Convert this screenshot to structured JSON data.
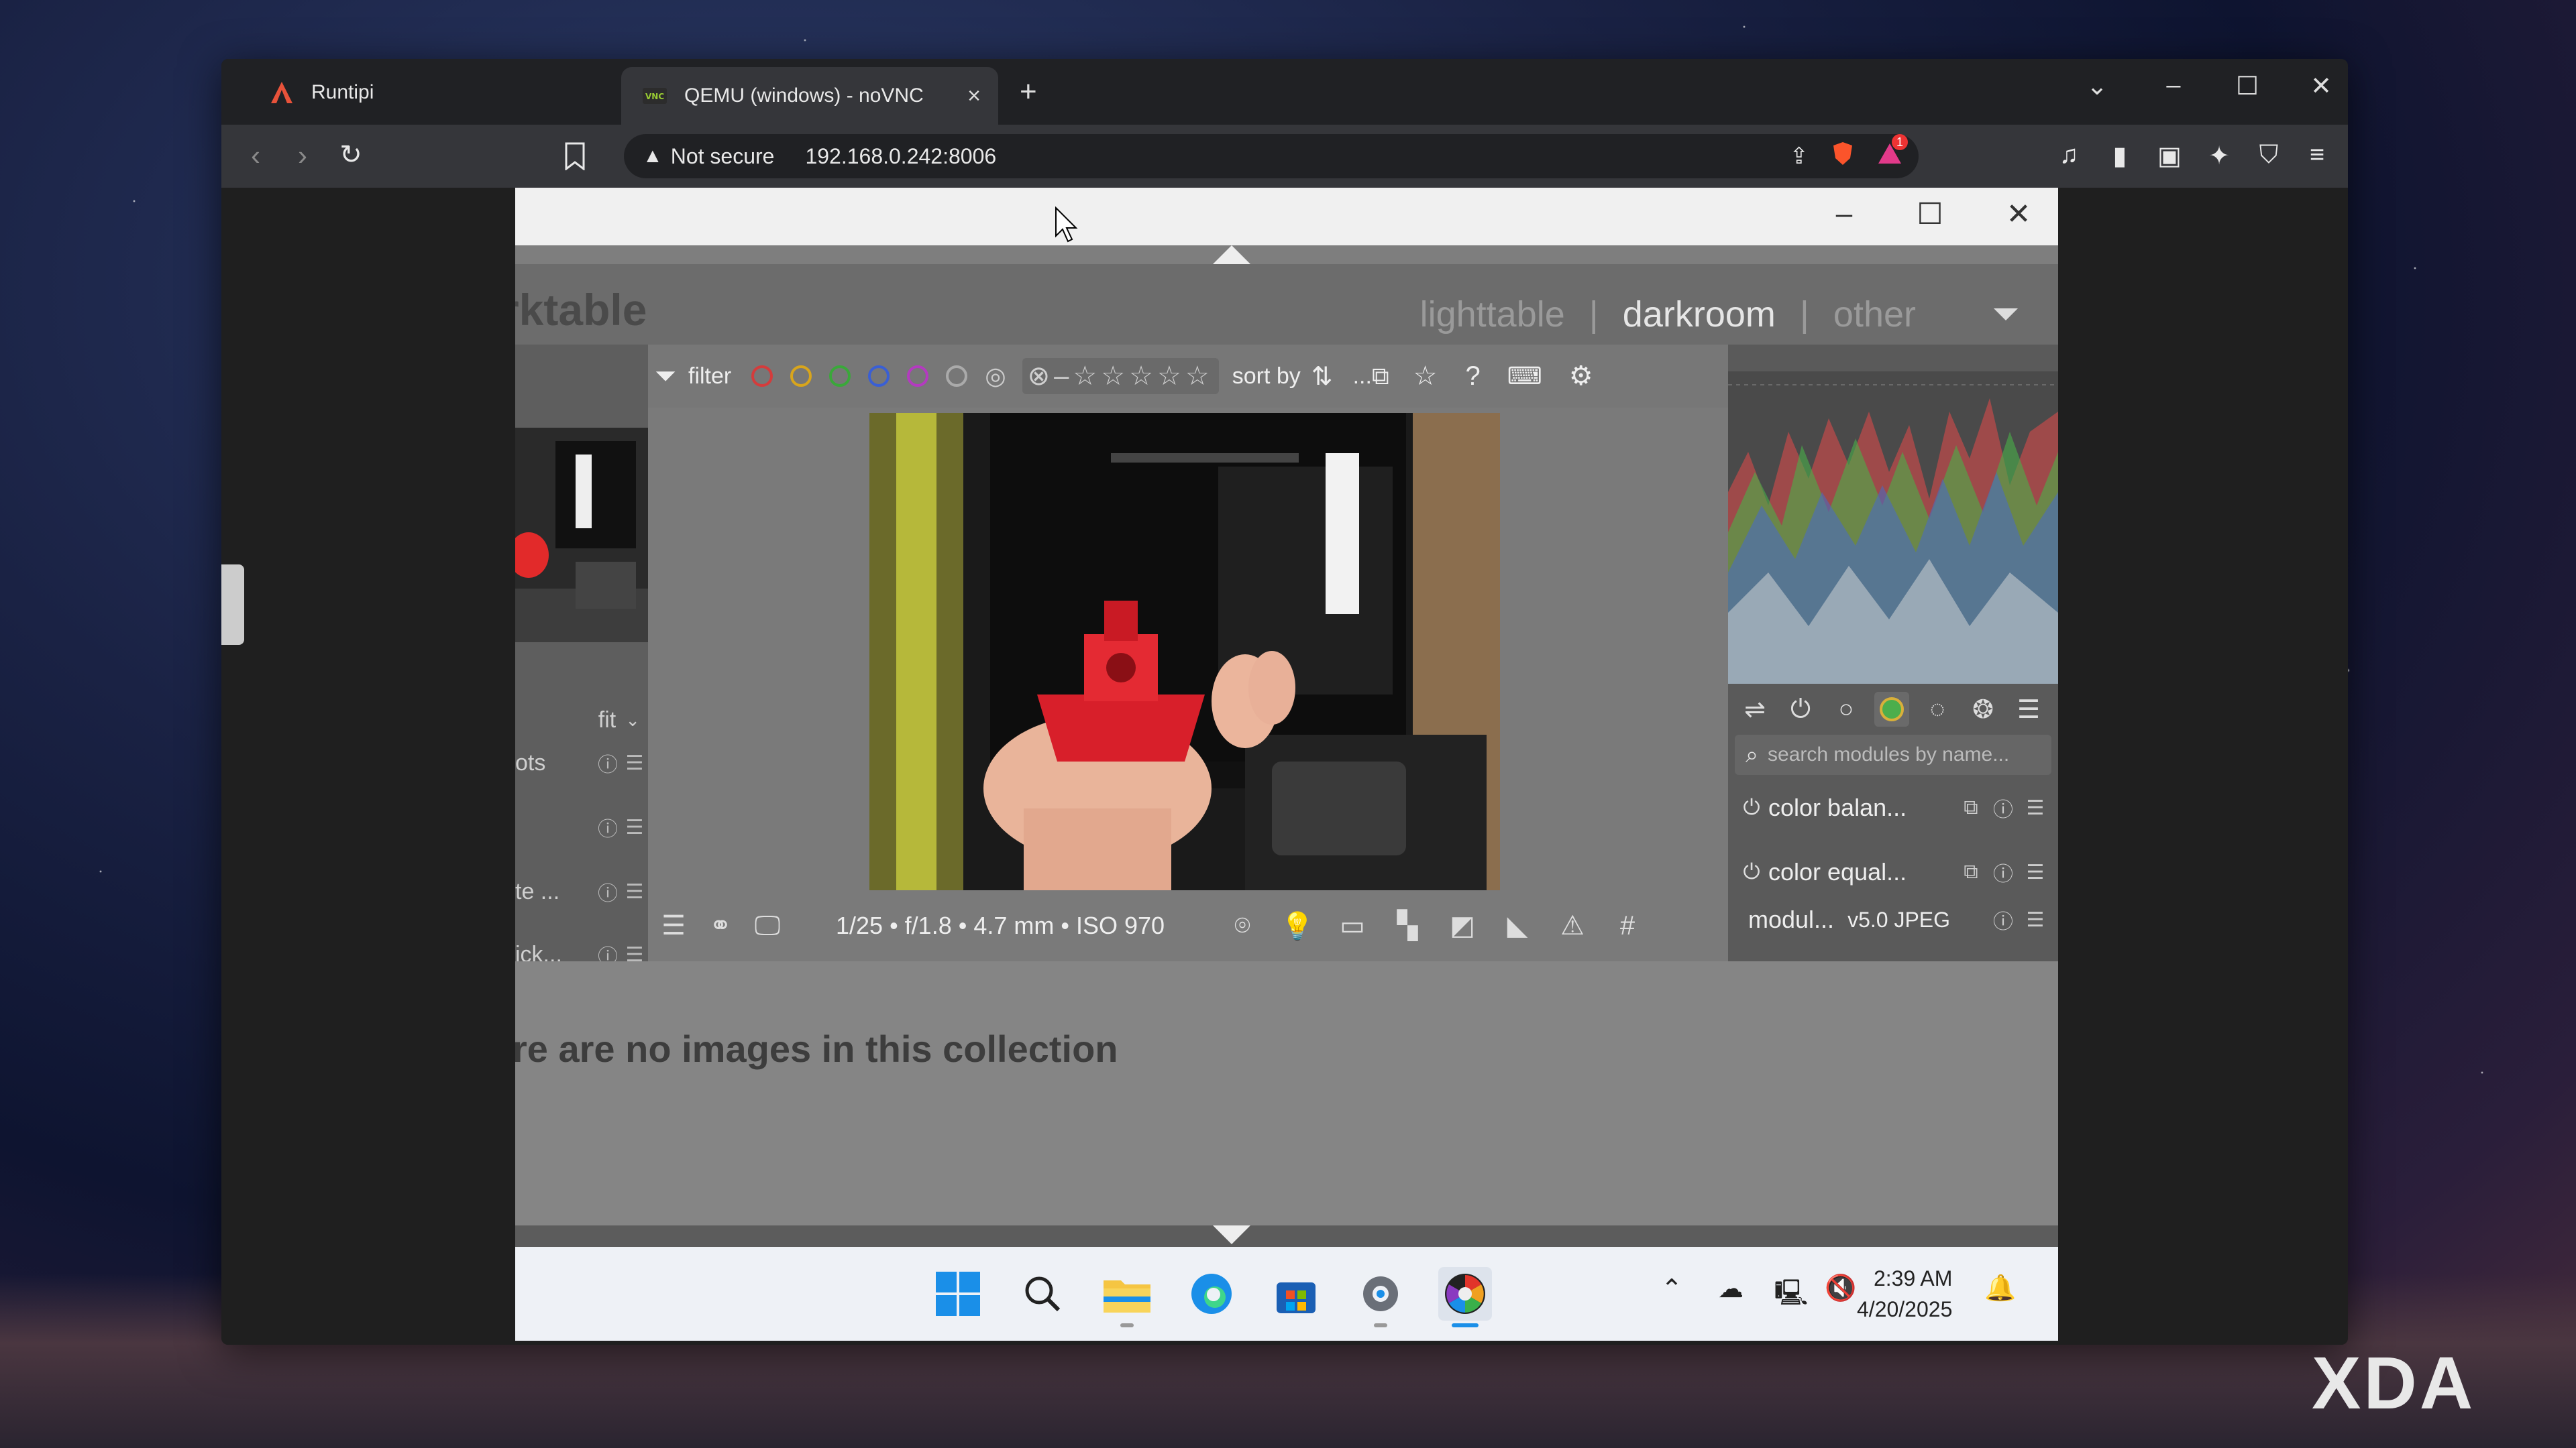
{
  "browser": {
    "tabs": [
      {
        "label": "Runtipi",
        "active": false
      },
      {
        "label": "QEMU (windows) - noVNC",
        "active": true
      }
    ],
    "new_tab": "+",
    "address": {
      "security": "Not secure",
      "url": "192.168.0.242:8006"
    },
    "shield_badge": "1"
  },
  "darktable": {
    "logo": "rktable",
    "views": {
      "lighttable": "lighttable",
      "sep1": "|",
      "darkroom": "darkroom",
      "sep2": "|",
      "other": "other"
    },
    "active_view": "darkroom",
    "toolbar": {
      "filter_label": "filter",
      "sort_label": "sort by",
      "ellipsis": "...",
      "label_colors": [
        "#d43c3c",
        "#d8a51c",
        "#3aa83a",
        "#3a5fd4",
        "#b43ac0"
      ]
    },
    "left_panel": {
      "zoom": "fit",
      "rows": [
        {
          "label": "ots"
        },
        {
          "label": ""
        },
        {
          "label": "te ..."
        },
        {
          "label": "ick..."
        }
      ]
    },
    "exif": "1/25 • f/1.8 • 4.7 mm • ISO 970",
    "right_panel": {
      "search_placeholder": "search modules by name...",
      "modules": [
        {
          "name": "color balan..."
        },
        {
          "name": "color equal..."
        }
      ],
      "preset_label": "modul...",
      "preset_value": "v5.0 JPEG"
    },
    "collection_message": "re are no images in this collection"
  },
  "taskbar": {
    "time": "2:39 AM",
    "date": "4/20/2025"
  },
  "watermark": "XDA"
}
